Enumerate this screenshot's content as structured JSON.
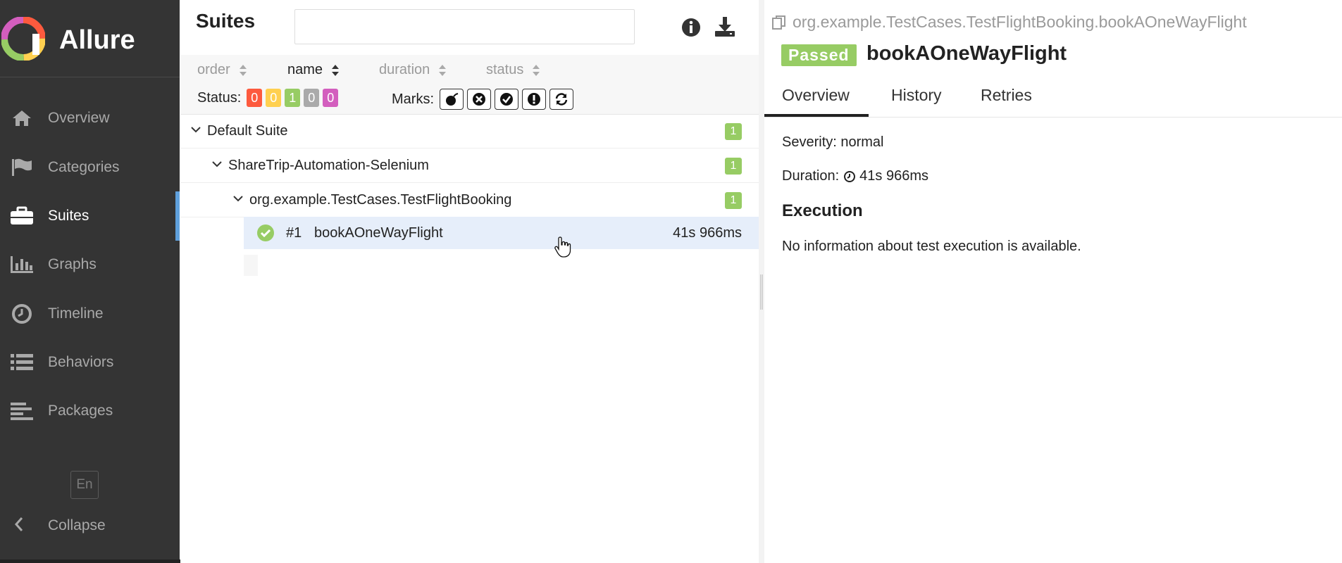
{
  "app": {
    "name": "Allure"
  },
  "sidebar": {
    "items": [
      {
        "label": "Overview",
        "icon": "home-icon"
      },
      {
        "label": "Categories",
        "icon": "flag-icon"
      },
      {
        "label": "Suites",
        "icon": "briefcase-icon",
        "active": true
      },
      {
        "label": "Graphs",
        "icon": "bar-chart-icon"
      },
      {
        "label": "Timeline",
        "icon": "clock-icon"
      },
      {
        "label": "Behaviors",
        "icon": "list-icon"
      },
      {
        "label": "Packages",
        "icon": "align-left-icon"
      }
    ],
    "language": "En",
    "collapse_label": "Collapse"
  },
  "suites_panel": {
    "title": "Suites",
    "search": {
      "value": "",
      "placeholder": ""
    },
    "sort": {
      "order": "order",
      "name": "name",
      "duration": "duration",
      "status": "status"
    },
    "status_label": "Status:",
    "status_counts": [
      {
        "value": "0",
        "color": "#fd5a3e"
      },
      {
        "value": "0",
        "color": "#ffd050"
      },
      {
        "value": "1",
        "color": "#97cc64"
      },
      {
        "value": "0",
        "color": "#aaaaaa"
      },
      {
        "value": "0",
        "color": "#d35ebe"
      }
    ],
    "marks_label": "Marks:",
    "tree": {
      "suite": {
        "label": "Default Suite",
        "count": "1"
      },
      "project": {
        "label": "ShareTrip-Automation-Selenium",
        "count": "1"
      },
      "class": {
        "label": "org.example.TestCases.TestFlightBooking",
        "count": "1"
      },
      "test": {
        "number": "#1",
        "name": "bookAOneWayFlight",
        "duration": "41s 966ms"
      }
    }
  },
  "details": {
    "path": "org.example.TestCases.TestFlightBooking.bookAOneWayFlight",
    "status": "Passed",
    "title": "bookAOneWayFlight",
    "tabs": [
      "Overview",
      "History",
      "Retries"
    ],
    "severity": "Severity: normal",
    "duration_label": "Duration:",
    "duration_value": "41s 966ms",
    "execution_heading": "Execution",
    "execution_text": "No information about test execution is available."
  },
  "colors": {
    "passed": "#97cc64",
    "sidebar_bg": "#343434",
    "active_marker": "#5fa0dc"
  }
}
